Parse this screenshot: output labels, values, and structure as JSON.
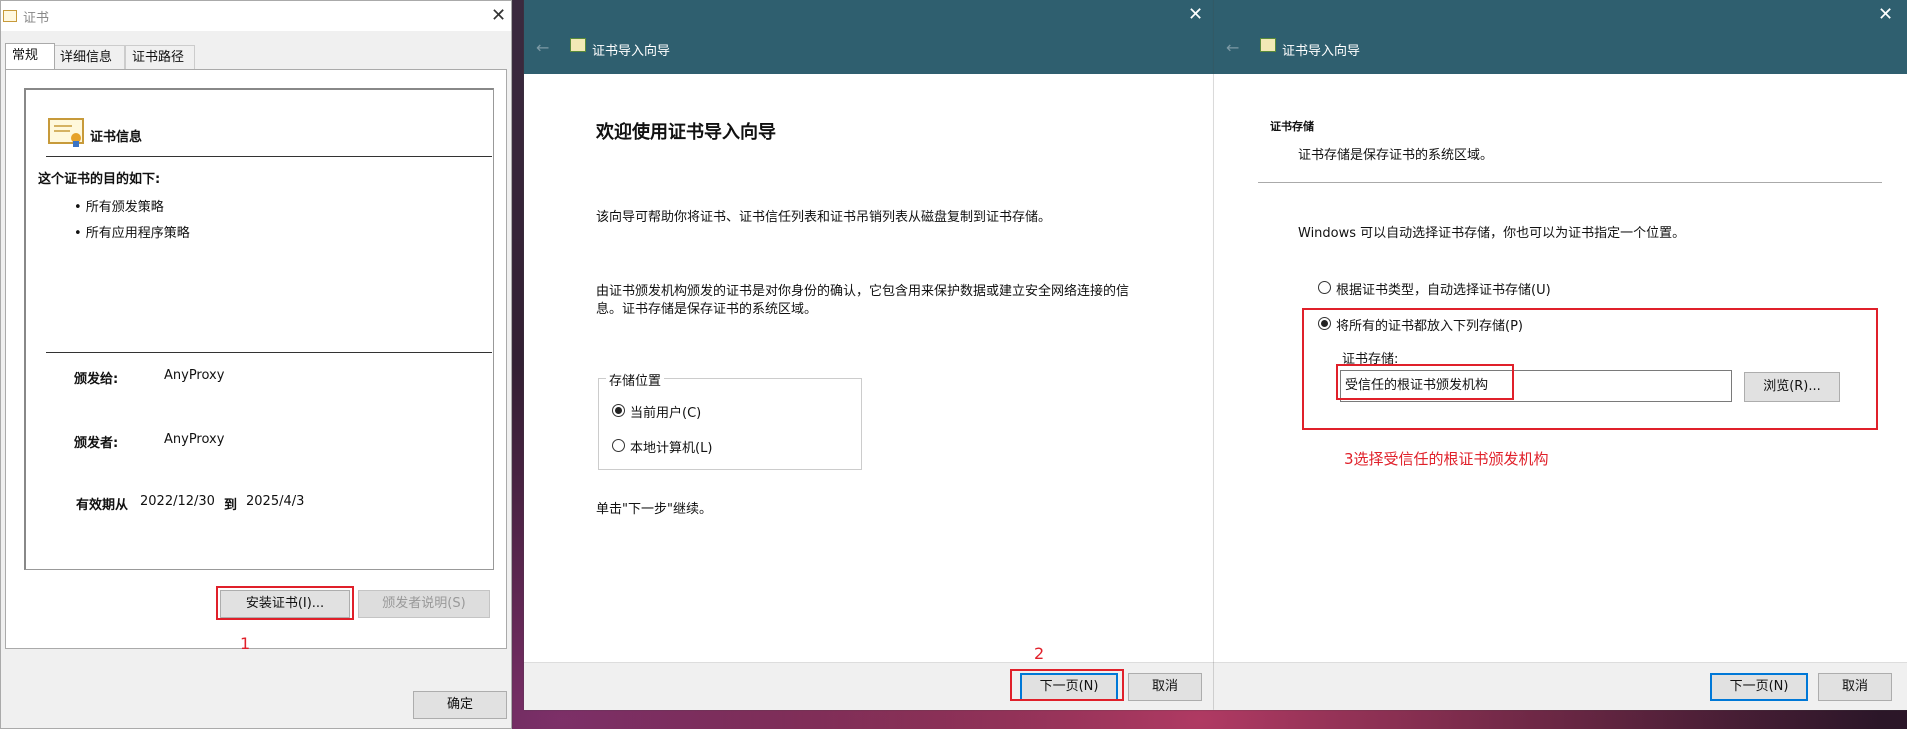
{
  "cert_window": {
    "title": "证书",
    "tabs": [
      "常规",
      "详细信息",
      "证书路径"
    ],
    "info_title": "证书信息",
    "purpose_heading": "这个证书的目的如下:",
    "purposes": [
      "• 所有颁发策略",
      "• 所有应用程序策略"
    ],
    "issued_to_label": "颁发给:",
    "issued_to": "AnyProxy",
    "issued_by_label": "颁发者:",
    "issued_by": "AnyProxy",
    "valid_from_label": "有效期从",
    "valid_from": "2022/12/30",
    "valid_to_label": "到",
    "valid_to": "2025/4/3",
    "install_button": "安装证书(I)...",
    "issuer_statement_button": "颁发者说明(S)",
    "ok_button": "确定",
    "step_annotation": "1"
  },
  "wizard1": {
    "title": "证书导入向导",
    "heading": "欢迎使用证书导入向导",
    "para1": "该向导可帮助你将证书、证书信任列表和证书吊销列表从磁盘复制到证书存储。",
    "para2_line1": "由证书颁发机构颁发的证书是对你身份的确认，它包含用来保护数据或建立安全网络连接的信",
    "para2_line2": "息。证书存储是保存证书的系统区域。",
    "store_group_label": "存储位置",
    "options": [
      {
        "label": "当前用户(C)",
        "selected": true
      },
      {
        "label": "本地计算机(L)",
        "selected": false
      }
    ],
    "continue_hint": "单击\"下一步\"继续。",
    "next_button": "下一页(N)",
    "cancel_button": "取消",
    "step_annotation": "2"
  },
  "wizard2": {
    "title": "证书导入向导",
    "section_title": "证书存储",
    "section_desc": "证书存储是保存证书的系统区域。",
    "intro": "Windows 可以自动选择证书存储，你也可以为证书指定一个位置。",
    "options": [
      {
        "label": "根据证书类型，自动选择证书存储(U)",
        "selected": false
      },
      {
        "label": "将所有的证书都放入下列存储(P)",
        "selected": true
      }
    ],
    "store_label": "证书存储:",
    "store_value": "受信任的根证书颁发机构",
    "browse_button": "浏览(R)...",
    "annotation": "3选择受信任的根证书颁发机构",
    "next_button": "下一页(N)",
    "cancel_button": "取消"
  },
  "colors": {
    "header_teal": "#2f5f6f",
    "annotation_red": "#e0202a",
    "focus_blue": "#0078d7"
  }
}
